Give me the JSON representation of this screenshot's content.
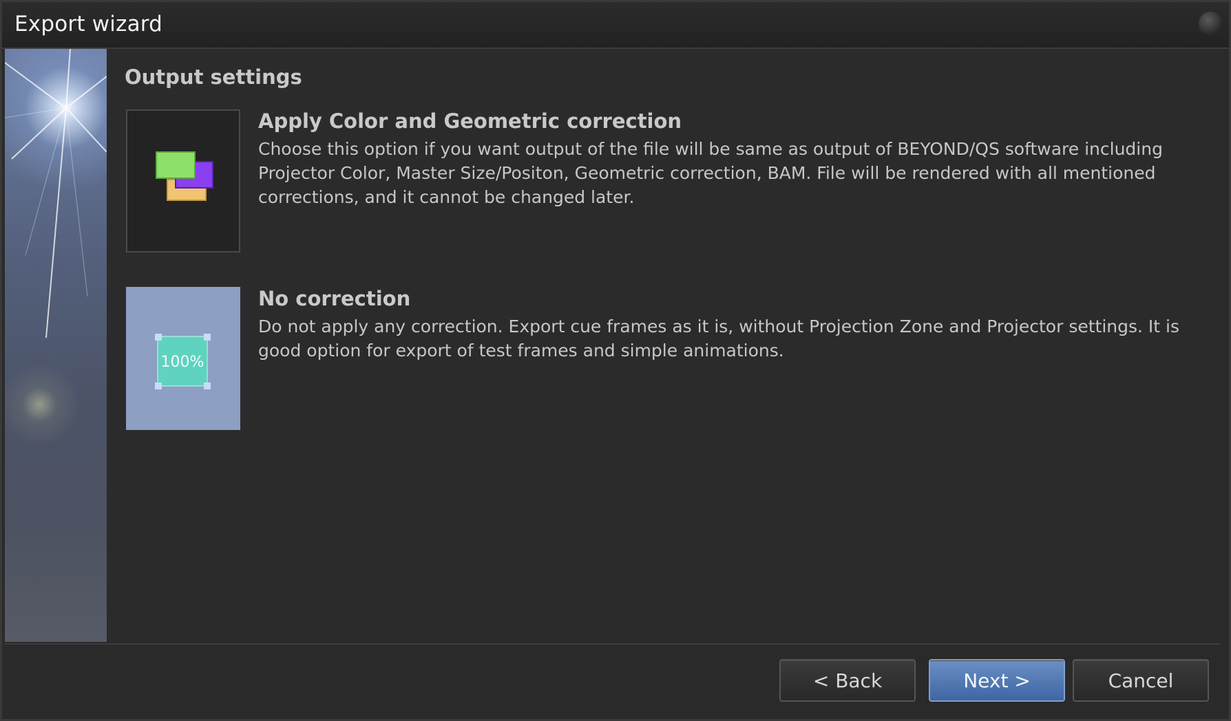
{
  "window": {
    "title": "Export wizard"
  },
  "page": {
    "section_title": "Output settings"
  },
  "options": [
    {
      "heading": "Apply Color and Geometric correction",
      "description": "Choose this option if you want output of the file will be same as output of BEYOND/QS software including Projector Color, Master Size/Positon, Geometric correction, BAM. File will be rendered with all mentioned corrections, and it cannot be changed later.",
      "icon": "layers-icon"
    },
    {
      "heading": "No correction",
      "description": "Do not apply any correction. Export cue frames as it is, without Projection Zone and Projector settings. It is good option for export of test frames and simple animations.",
      "icon_label": "100%",
      "icon": "scale-100-icon"
    }
  ],
  "buttons": {
    "back": "< Back",
    "next": "Next >",
    "cancel": "Cancel"
  },
  "colors": {
    "background": "#2b2b2b",
    "accent": "#4f78b8",
    "text": "#c6c6c6"
  }
}
